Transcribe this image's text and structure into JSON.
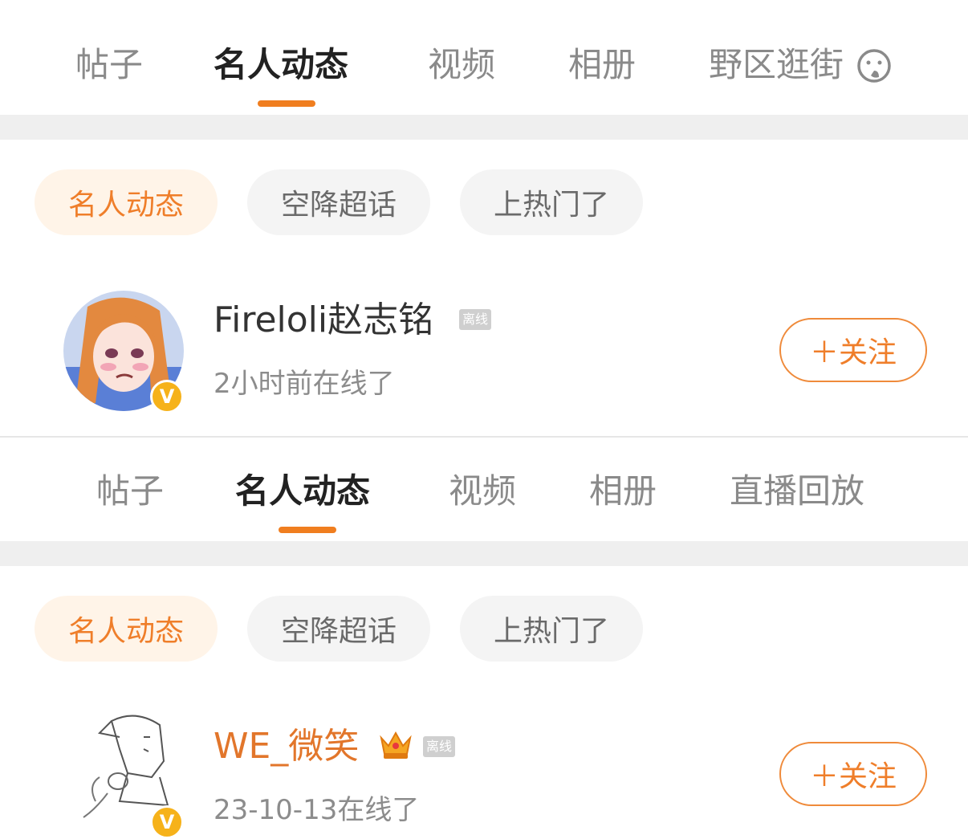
{
  "section1": {
    "tabs": [
      {
        "label": "帖子"
      },
      {
        "label": "名人动态"
      },
      {
        "label": "视频"
      },
      {
        "label": "相册"
      },
      {
        "label": "野区逛街"
      }
    ],
    "active_tab": "名人动态",
    "filters": [
      {
        "label": "名人动态"
      },
      {
        "label": "空降超话"
      },
      {
        "label": "上热门了"
      }
    ],
    "active_filter": "名人动态",
    "user": {
      "name": "Fireloli赵志铭",
      "status_tag": "离线",
      "last_seen": "2小时前在线了",
      "verified_badge": "V",
      "follow_label": "＋关注"
    }
  },
  "section2": {
    "tabs": [
      {
        "label": "帖子"
      },
      {
        "label": "名人动态"
      },
      {
        "label": "视频"
      },
      {
        "label": "相册"
      },
      {
        "label": "直播回放"
      }
    ],
    "active_tab": "名人动态",
    "filters": [
      {
        "label": "名人动态"
      },
      {
        "label": "空降超话"
      },
      {
        "label": "上热门了"
      }
    ],
    "active_filter": "名人动态",
    "user": {
      "name": "WE_微笑",
      "status_tag": "离线",
      "last_seen": "23-10-13在线了",
      "verified_badge": "V",
      "follow_label": "＋关注",
      "crown_icon": "crown-icon"
    }
  },
  "colors": {
    "accent": "#f07e1f",
    "pill_active_bg": "#fff4e8",
    "separator": "#efefef"
  }
}
